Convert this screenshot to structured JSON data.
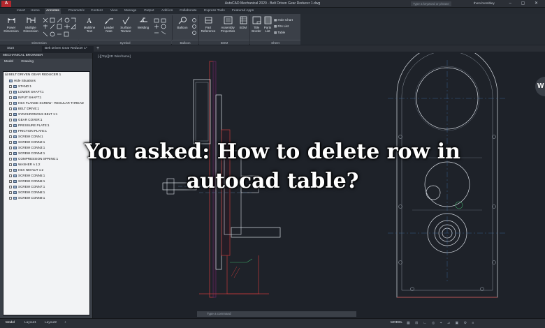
{
  "titlebar": {
    "logo": "A",
    "title": "AutoCAD Mechanical 2020 - Belt Driven Gear Reducer 1.dwg",
    "search": "Type a keyword or phrase",
    "user": "thom.brembley",
    "window_buttons": "– ▢ ✕"
  },
  "ribbon_tabs": [
    "Insert",
    "Home",
    "Annotate",
    "Parametric",
    "Content",
    "View",
    "Manage",
    "Output",
    "Add-ins",
    "Collaborate",
    "Express Tools",
    "Featured Apps"
  ],
  "ribbon": {
    "buttons": [
      {
        "label": "Power\nDimension"
      },
      {
        "label": "Multiple\nDimension"
      },
      {
        "label": "Multiline\nText"
      },
      {
        "label": "Leader\nNote"
      },
      {
        "label": "Surface\nTexture"
      },
      {
        "label": "Welding"
      },
      {
        "label": "Balloon"
      },
      {
        "label": "Part\nReference"
      },
      {
        "label": "Assembly\nProperties"
      },
      {
        "label": "BOM"
      },
      {
        "label": "Title\nBorder"
      },
      {
        "label": "Parts\nList"
      }
    ],
    "side_items": [
      "Hole Chart",
      "Fits List",
      "Table"
    ],
    "groups": [
      "Dimension",
      "Symbol",
      "Balloon",
      "BOM",
      "Sheet"
    ]
  },
  "doc_tabs": [
    "Start",
    "Belt Driven Gear Reducer 1*"
  ],
  "browser": {
    "title": "MECHANICAL BROWSER",
    "subtabs": [
      "Model",
      "Drawing"
    ],
    "root": "BELT DRIVEN GEAR REDUCER 1",
    "items": [
      "Hide Situations",
      "STAND:1",
      "LOWER SHAFT:1",
      "INPUT SHAFT:1",
      "HEX FLANGE SCREW - REGULAR THREAD",
      "BELT DRIVE:1",
      "SYNCHRONOUS BELT 1:1",
      "GEAR COVER:1",
      "PRESSURE PLATE:1",
      "FRICTION PLATE:1",
      "SCREW CONN:1",
      "SCREW CONN2:1",
      "SCREW CONN3:1",
      "SCREW CONN4:1",
      "COMPRESSION SPRING:1",
      "WASHER A 1:2",
      "HEX NM NUT 1:2",
      "SCREW CONN5:1",
      "SCREW CONN6:1",
      "SCREW CONN7:1",
      "SCREW CONN8:1",
      "SCREW CONN9:1"
    ]
  },
  "canvas": {
    "view_label": "[-][Top][2D Wireframe]"
  },
  "command_line": {
    "placeholder": "Type a command"
  },
  "status": {
    "layout_tabs": [
      "Model",
      "Layout1",
      "Layout2",
      "+"
    ],
    "model": "MODEL"
  },
  "headline": {
    "line1": "You asked: How to delete row in",
    "line2": "autocad table?"
  },
  "watermark": "W"
}
